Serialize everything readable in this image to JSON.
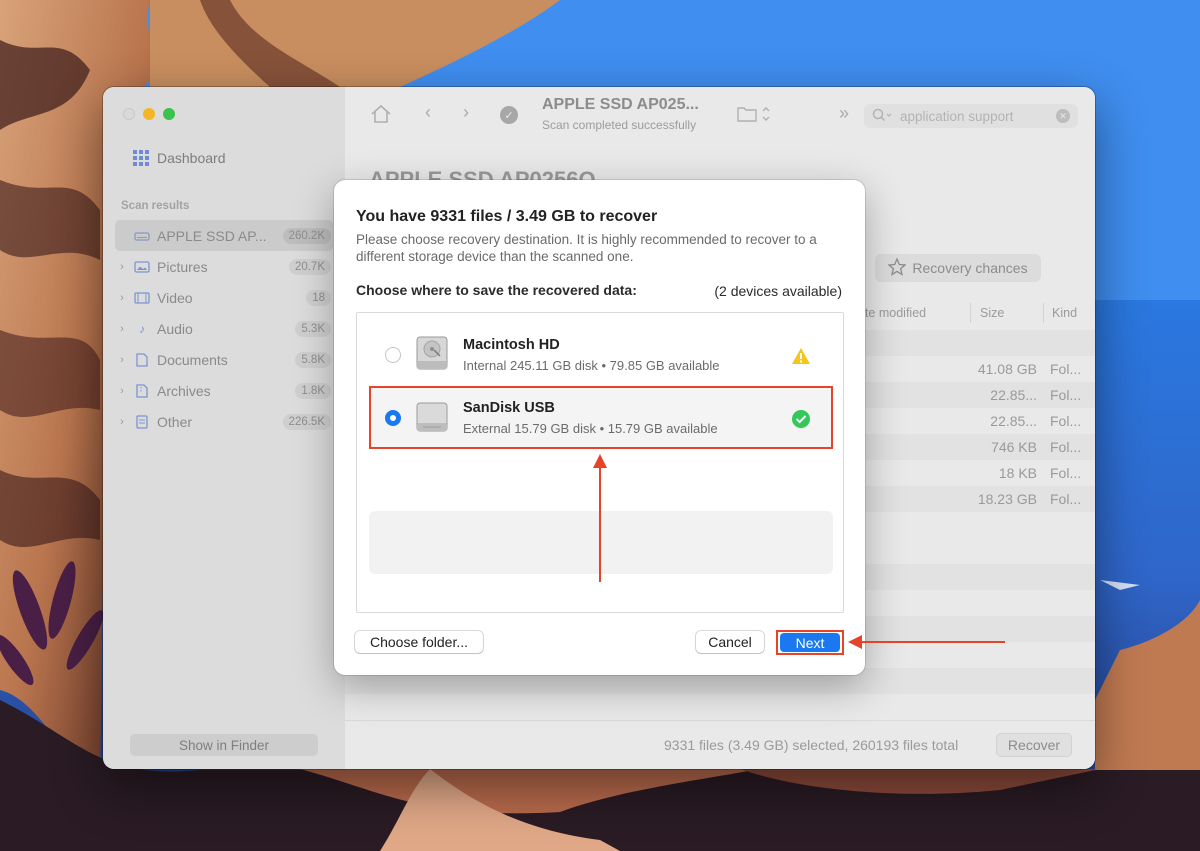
{
  "window": {
    "sidebar": {
      "dashboard_label": "Dashboard",
      "section_label": "Scan results",
      "items": [
        {
          "label": "APPLE SSD AP...",
          "count": "260.2K",
          "icon": "drive-icon",
          "active": true
        },
        {
          "label": "Pictures",
          "count": "20.7K",
          "icon": "pictures-icon"
        },
        {
          "label": "Video",
          "count": "18",
          "icon": "video-icon"
        },
        {
          "label": "Audio",
          "count": "5.3K",
          "icon": "audio-icon"
        },
        {
          "label": "Documents",
          "count": "5.8K",
          "icon": "documents-icon"
        },
        {
          "label": "Archives",
          "count": "1.8K",
          "icon": "archives-icon"
        },
        {
          "label": "Other",
          "count": "226.5K",
          "icon": "other-icon"
        }
      ],
      "show_in_finder": "Show in Finder"
    },
    "toolbar": {
      "title": "APPLE SSD AP025...",
      "subtitle": "Scan completed successfully",
      "search_value": "application support"
    },
    "main": {
      "heading": "APPLE SSD AP0256Q",
      "recovery_chances": "Recovery chances",
      "columns": {
        "date_modified": "ate modified",
        "size": "Size",
        "kind": "Kind"
      },
      "rows": [
        {
          "size": "41.08 GB",
          "kind": "Fol..."
        },
        {
          "size": "22.85...",
          "kind": "Fol..."
        },
        {
          "size": "22.85...",
          "kind": "Fol..."
        },
        {
          "size": "746 KB",
          "kind": "Fol..."
        },
        {
          "size": "18 KB",
          "kind": "Fol..."
        },
        {
          "size": "18.23 GB",
          "kind": "Fol..."
        }
      ]
    },
    "status": {
      "text": "9331 files (3.49 GB) selected, 260193 files total",
      "recover_button": "Recover"
    }
  },
  "dialog": {
    "title": "You have 9331 files / 3.49 GB to recover",
    "description": "Please choose recovery destination. It is highly recommended to recover to a different storage device than the scanned one.",
    "choose_label": "Choose where to save the recovered data:",
    "devices_available": "(2 devices available)",
    "devices": [
      {
        "name": "Macintosh HD",
        "info": "Internal 245.11 GB disk • 79.85 GB available",
        "selected": false,
        "status": "warning"
      },
      {
        "name": "SanDisk USB",
        "info": "External 15.79 GB disk • 15.79 GB available",
        "selected": true,
        "status": "ok"
      }
    ],
    "buttons": {
      "choose_folder": "Choose folder...",
      "cancel": "Cancel",
      "next": "Next"
    }
  },
  "colors": {
    "accent": "#1a79f0",
    "annotation": "#e5432a",
    "ok": "#34c759",
    "warning": "#f5c518"
  }
}
